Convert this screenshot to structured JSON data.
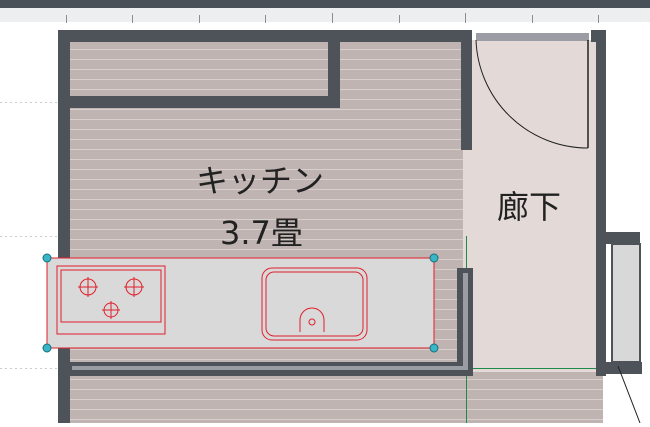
{
  "plan": {
    "rooms": [
      {
        "id": "kitchen",
        "name": "キッチン",
        "area": "3.7畳"
      },
      {
        "id": "hallway",
        "name": "廊下"
      }
    ],
    "fixtures": [
      {
        "id": "counter",
        "type": "kitchen-counter",
        "parts": [
          "stove-3-burner",
          "sink"
        ],
        "selected": true
      }
    ],
    "colors": {
      "wall": "#4e535a",
      "wall_inner": "#9a9ea4",
      "floor_wood": "#bfb4b1",
      "floor_hall": "#e3dad7",
      "selection": "#e0202a",
      "handle": "#38b6c6",
      "guide_green": "#1f8a4c",
      "ruler": "#4a5058"
    }
  }
}
